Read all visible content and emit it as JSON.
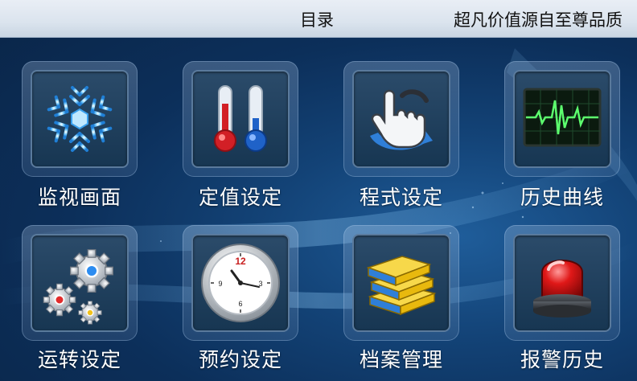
{
  "header": {
    "title": "目录",
    "slogan": "超凡价值源自至尊品质"
  },
  "menu": [
    {
      "label": "监视画面",
      "icon": "snowflake-icon"
    },
    {
      "label": "定值设定",
      "icon": "thermometer-icon"
    },
    {
      "label": "程式设定",
      "icon": "hand-pointer-icon"
    },
    {
      "label": "历史曲线",
      "icon": "waveform-monitor-icon"
    },
    {
      "label": "运转设定",
      "icon": "gears-icon"
    },
    {
      "label": "预约设定",
      "icon": "clock-icon"
    },
    {
      "label": "档案管理",
      "icon": "books-icon"
    },
    {
      "label": "报警历史",
      "icon": "alarm-beacon-icon"
    }
  ],
  "clock": {
    "hour_numerals": [
      "12",
      "3",
      "6",
      "9"
    ]
  },
  "colors": {
    "accent_blue": "#0c2f5a",
    "label_text": "#ffffff",
    "header_bg": "#dbe4ee"
  }
}
